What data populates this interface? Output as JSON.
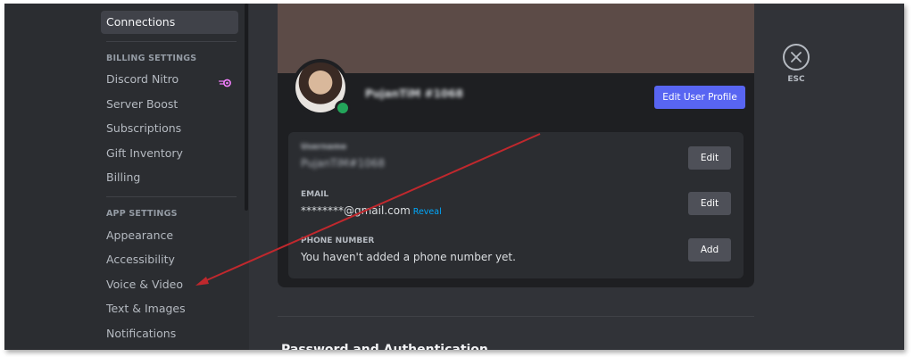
{
  "sidebar": {
    "top_item": "Connections",
    "billing_header": "BILLING SETTINGS",
    "billing_items": [
      "Discord Nitro",
      "Server Boost",
      "Subscriptions",
      "Gift Inventory",
      "Billing"
    ],
    "app_header": "APP SETTINGS",
    "app_items": [
      "Appearance",
      "Accessibility",
      "Voice & Video",
      "Text & Images",
      "Notifications"
    ]
  },
  "profile": {
    "username_blurred": "PujanTiM #1068",
    "edit_profile_label": "Edit User Profile"
  },
  "account_info": {
    "username_label_blurred": "Username",
    "username_value_blurred": "PujanTiM#1068",
    "username_button": "Edit",
    "email_label": "EMAIL",
    "email_value": "********@gmail.com",
    "email_reveal": "Reveal",
    "email_button": "Edit",
    "phone_label": "PHONE NUMBER",
    "phone_value": "You haven't added a phone number yet.",
    "phone_button": "Add"
  },
  "next_section": {
    "heading": "Password and Authentication"
  },
  "close": {
    "label": "ESC",
    "icon": "close-icon"
  },
  "colors": {
    "accent": "#5865f2",
    "annotation_arrow": "#c0282d",
    "online_status": "#23a55a"
  }
}
